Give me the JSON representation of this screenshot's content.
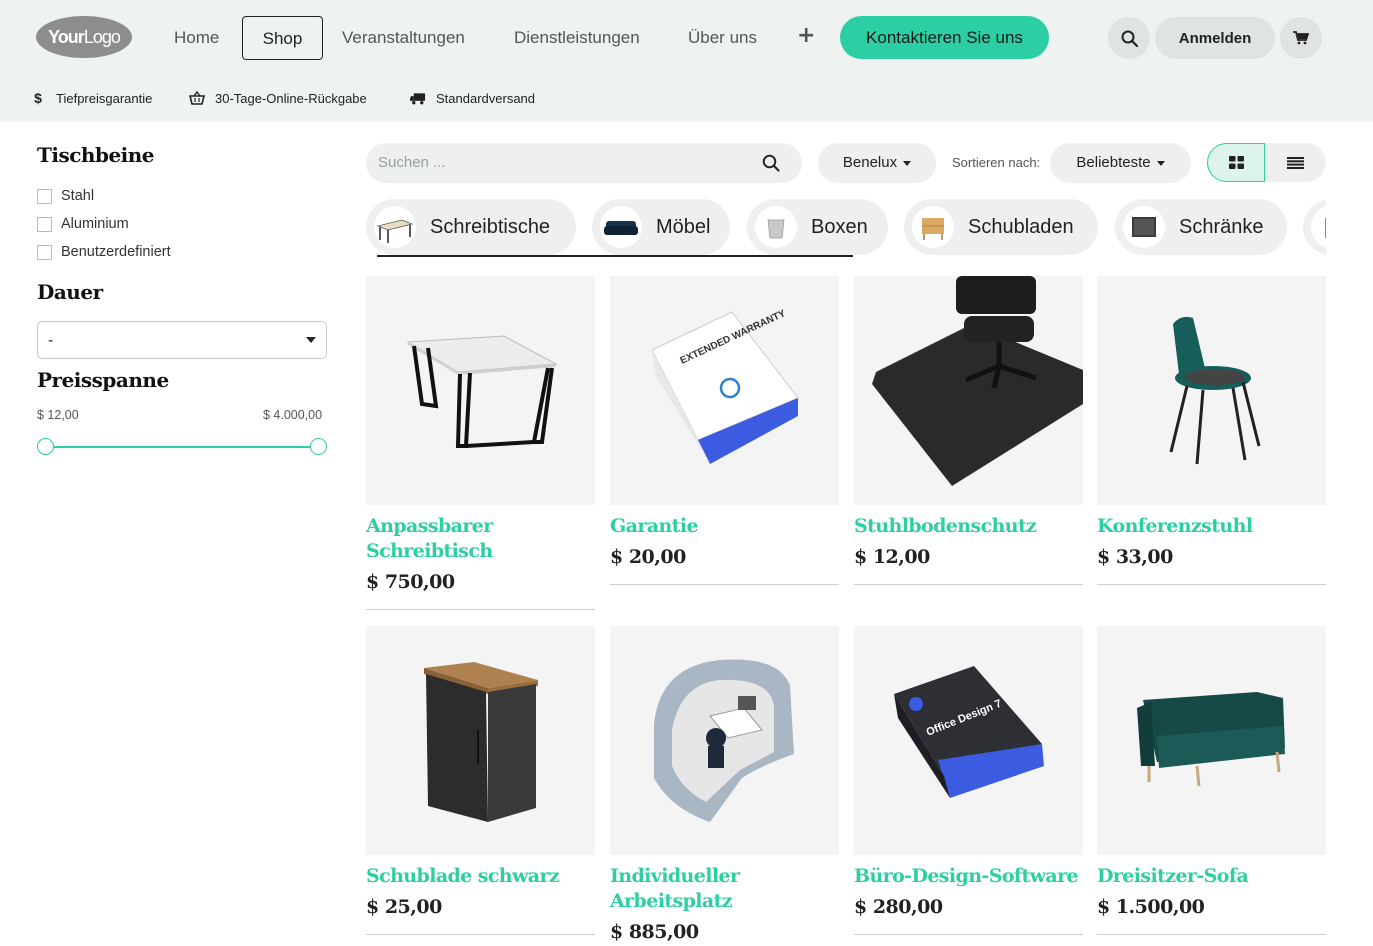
{
  "header": {
    "logo": {
      "bold": "Your",
      "light": "Logo"
    },
    "nav": [
      "Home",
      "Shop",
      "Veranstaltungen",
      "Dienstleistungen",
      "Über uns"
    ],
    "active_nav": "Shop",
    "contact_label": "Kontaktieren Sie uns",
    "login_label": "Anmelden",
    "perks": [
      "Tiefpreisgarantie",
      "30-Tage-Online-Rückgabe",
      "Standardversand"
    ]
  },
  "sidebar": {
    "legs_title": "Tischbeine",
    "legs_options": [
      "Stahl",
      "Aluminium",
      "Benutzerdefiniert"
    ],
    "duration_title": "Dauer",
    "duration_value": "-",
    "price_title": "Preisspanne",
    "price_min": "$ 12,00",
    "price_max": "$ 4.000,00"
  },
  "toolbar": {
    "search_placeholder": "Suchen ...",
    "pricelist": "Benelux",
    "sort_label": "Sortieren nach:",
    "sort_value": "Beliebteste"
  },
  "categories": [
    "Schreibtische",
    "Möbel",
    "Boxen",
    "Schubladen",
    "Schränke"
  ],
  "products": [
    {
      "name": "Anpassbarer Schreibtisch",
      "price": "$ 750,00"
    },
    {
      "name": "Garantie",
      "price": "$ 20,00"
    },
    {
      "name": "Stuhlbodenschutz",
      "price": "$ 12,00"
    },
    {
      "name": "Konferenzstuhl",
      "price": "$ 33,00"
    },
    {
      "name": "Schublade schwarz",
      "price": "$ 25,00"
    },
    {
      "name": "Individueller Arbeitsplatz",
      "price": "$ 885,00"
    },
    {
      "name": "Büro-Design-Software",
      "price": "$ 280,00"
    },
    {
      "name": "Dreisitzer-Sofa",
      "price": "$ 1.500,00"
    }
  ],
  "images": {
    "warranty_box_text": "EXTENDED WARRANTY",
    "software_box_text": "Office Design 7"
  },
  "colors": {
    "accent": "#2ccfa3",
    "header_bg": "#eef2f1"
  }
}
